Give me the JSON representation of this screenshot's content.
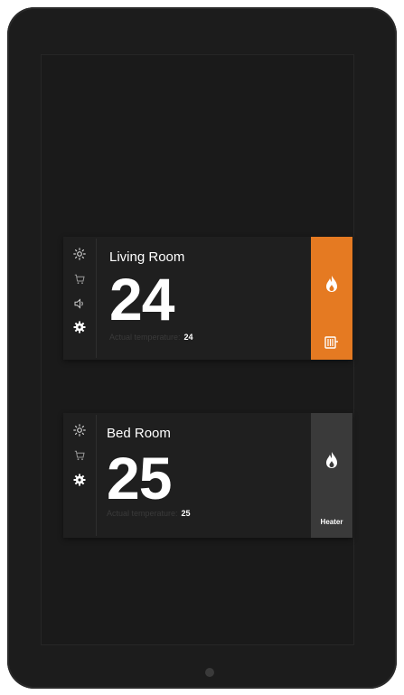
{
  "rooms": [
    {
      "name": "Living Room",
      "temperature": "24",
      "actual_label": "Actual temperature:",
      "actual_value": "24",
      "panel_color": "#e57a22",
      "panel_state": "active",
      "icons": [
        "sun-icon",
        "cart-icon",
        "speaker-icon",
        "gear-icon"
      ],
      "panel_icons": [
        "flame-icon",
        "radiator-icon"
      ]
    },
    {
      "name": "Bed Room",
      "temperature": "25",
      "actual_label": "Actual temperature:",
      "actual_value": "25",
      "panel_color": "#3a3a3a",
      "panel_state": "inactive",
      "panel_label": "Heater",
      "icons": [
        "sun-icon",
        "cart-icon",
        "gear-icon"
      ],
      "panel_icons": [
        "flame-icon"
      ]
    }
  ]
}
